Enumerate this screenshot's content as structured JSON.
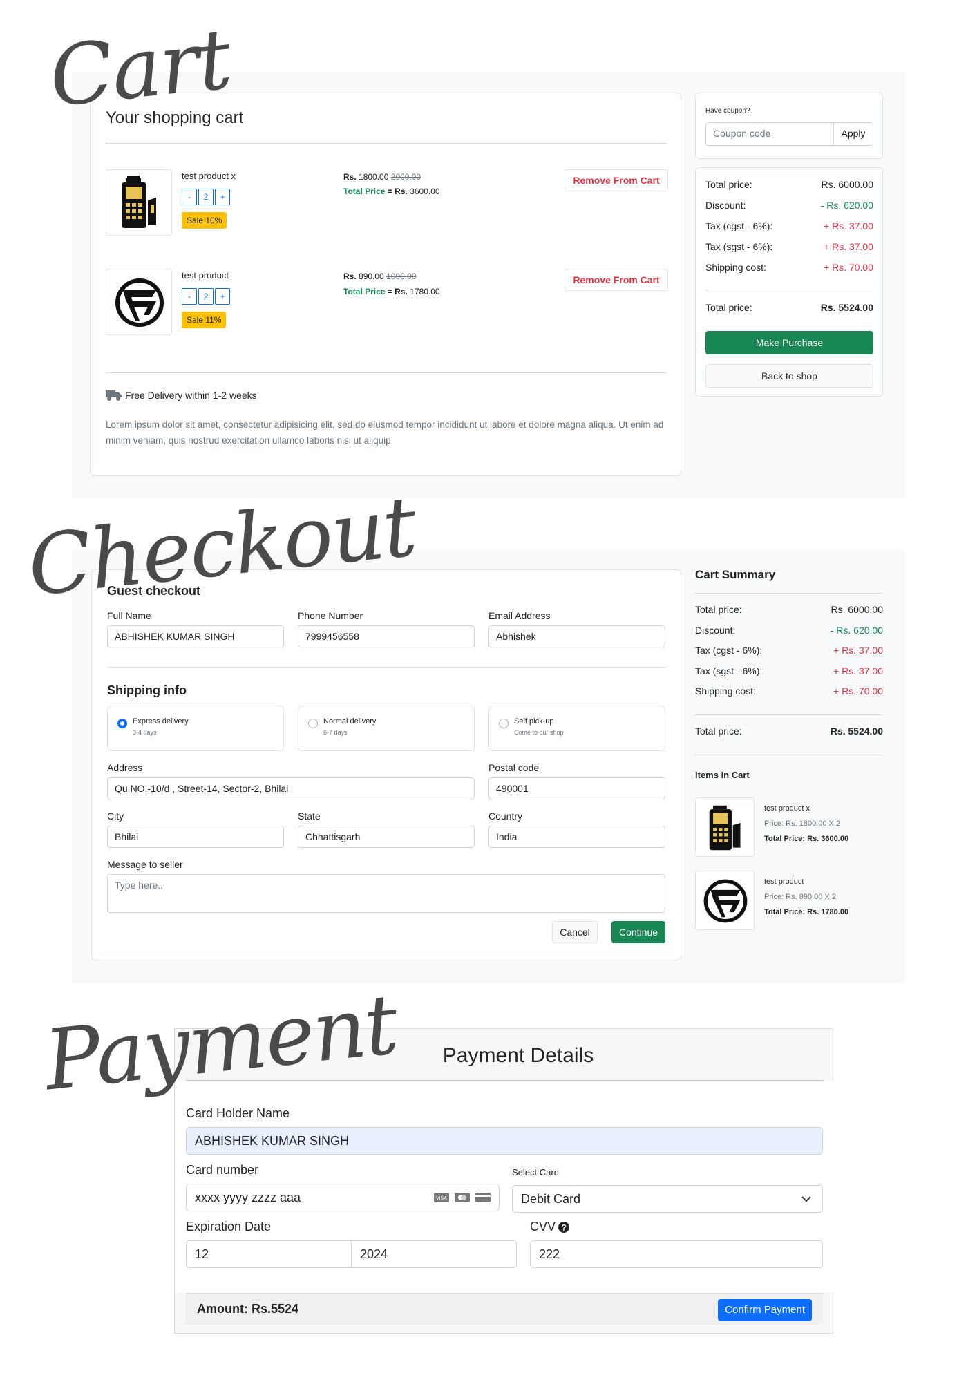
{
  "headings": {
    "cart": "Cart",
    "checkout": "Checkout",
    "payment": "Payment"
  },
  "cart": {
    "title": "Your shopping cart",
    "items": [
      {
        "name": "test product x",
        "qty": "2",
        "price": "1800.00",
        "old_price": "2000.00",
        "total": "3600.00",
        "sale": "Sale 10%"
      },
      {
        "name": "test product",
        "qty": "2",
        "price": "890.00",
        "old_price": "1000.00",
        "total": "1780.00",
        "sale": "Sale 11%"
      }
    ],
    "currency": "Rs.",
    "total_price_label": "Total Price",
    "equals": "=",
    "remove_label": "Remove From Cart",
    "qty_minus": "-",
    "qty_plus": "+",
    "delivery_note": "Free Delivery within 1-2 weeks",
    "description": "Lorem ipsum dolor sit amet, consectetur adipisicing elit, sed do eiusmod tempor incididunt ut labore et dolore magna aliqua. Ut enim ad minim veniam, quis nostrud exercitation ullamco laboris nisi ut aliquip"
  },
  "coupon": {
    "label": "Have coupon?",
    "placeholder": "Coupon code",
    "apply": "Apply"
  },
  "summary": {
    "total_price_label": "Total price:",
    "total_price": "Rs. 6000.00",
    "discount_label": "Discount:",
    "discount": "- Rs. 620.00",
    "tax_cgst_label": "Tax (cgst - 6%):",
    "tax_cgst": "+ Rs. 37.00",
    "tax_sgst_label": "Tax (sgst - 6%):",
    "tax_sgst": "+ Rs. 37.00",
    "shipping_label": "Shipping cost:",
    "shipping": "+ Rs. 70.00",
    "final_label": "Total price:",
    "final": "Rs. 5524.00",
    "make_purchase": "Make Purchase",
    "back_to_shop": "Back to shop"
  },
  "checkout": {
    "guest_title": "Guest checkout",
    "full_name_label": "Full Name",
    "full_name": "ABHISHEK KUMAR SINGH",
    "phone_label": "Phone Number",
    "phone": "7999456558",
    "email_label": "Email Address",
    "email": "Abhishek",
    "shipping_title": "Shipping info",
    "options": [
      {
        "title": "Express delivery",
        "sub": "3-4 days"
      },
      {
        "title": "Normal delivery",
        "sub": "6-7 days"
      },
      {
        "title": "Self pick-up",
        "sub": "Come to our shop"
      }
    ],
    "address_label": "Address",
    "address": "Qu NO.-10/d , Street-14, Sector-2, Bhilai",
    "postal_label": "Postal code",
    "postal": "490001",
    "city_label": "City",
    "city": "Bhilai",
    "state_label": "State",
    "state": "Chhattisgarh",
    "country_label": "Country",
    "country": "India",
    "message_label": "Message to seller",
    "message_placeholder": "Type here..",
    "cancel": "Cancel",
    "continue": "Continue"
  },
  "cart_summary": {
    "title": "Cart Summary",
    "items_title": "Items In Cart",
    "items": [
      {
        "name": "test product x",
        "price_line": "Price: Rs. 1800.00 X 2",
        "total_line": "Total Price: Rs. 3600.00"
      },
      {
        "name": "test product",
        "price_line": "Price: Rs. 890.00 X 2",
        "total_line": "Total Price: Rs. 1780.00"
      }
    ]
  },
  "payment": {
    "title": "Payment Details",
    "holder_label": "Card Holder Name",
    "holder": "ABHISHEK KUMAR SINGH",
    "number_label": "Card number",
    "number": "xxxx yyyy zzzz aaa",
    "select_label": "Select Card",
    "select_value": "Debit Card",
    "exp_label": "Expiration Date",
    "exp_month": "12",
    "exp_year": "2024",
    "cvv_label": "CVV",
    "cvv": "222",
    "amount": "Amount: Rs.5524",
    "confirm": "Confirm Payment"
  },
  "icons": [
    "truck-icon",
    "visa-icon",
    "mastercard-icon",
    "card-icon",
    "question-circle-icon",
    "chevron-down-icon"
  ],
  "colors": {
    "primary": "#0d6efd",
    "success": "#198754",
    "danger": "#dc3545",
    "warning": "#ffc107"
  }
}
